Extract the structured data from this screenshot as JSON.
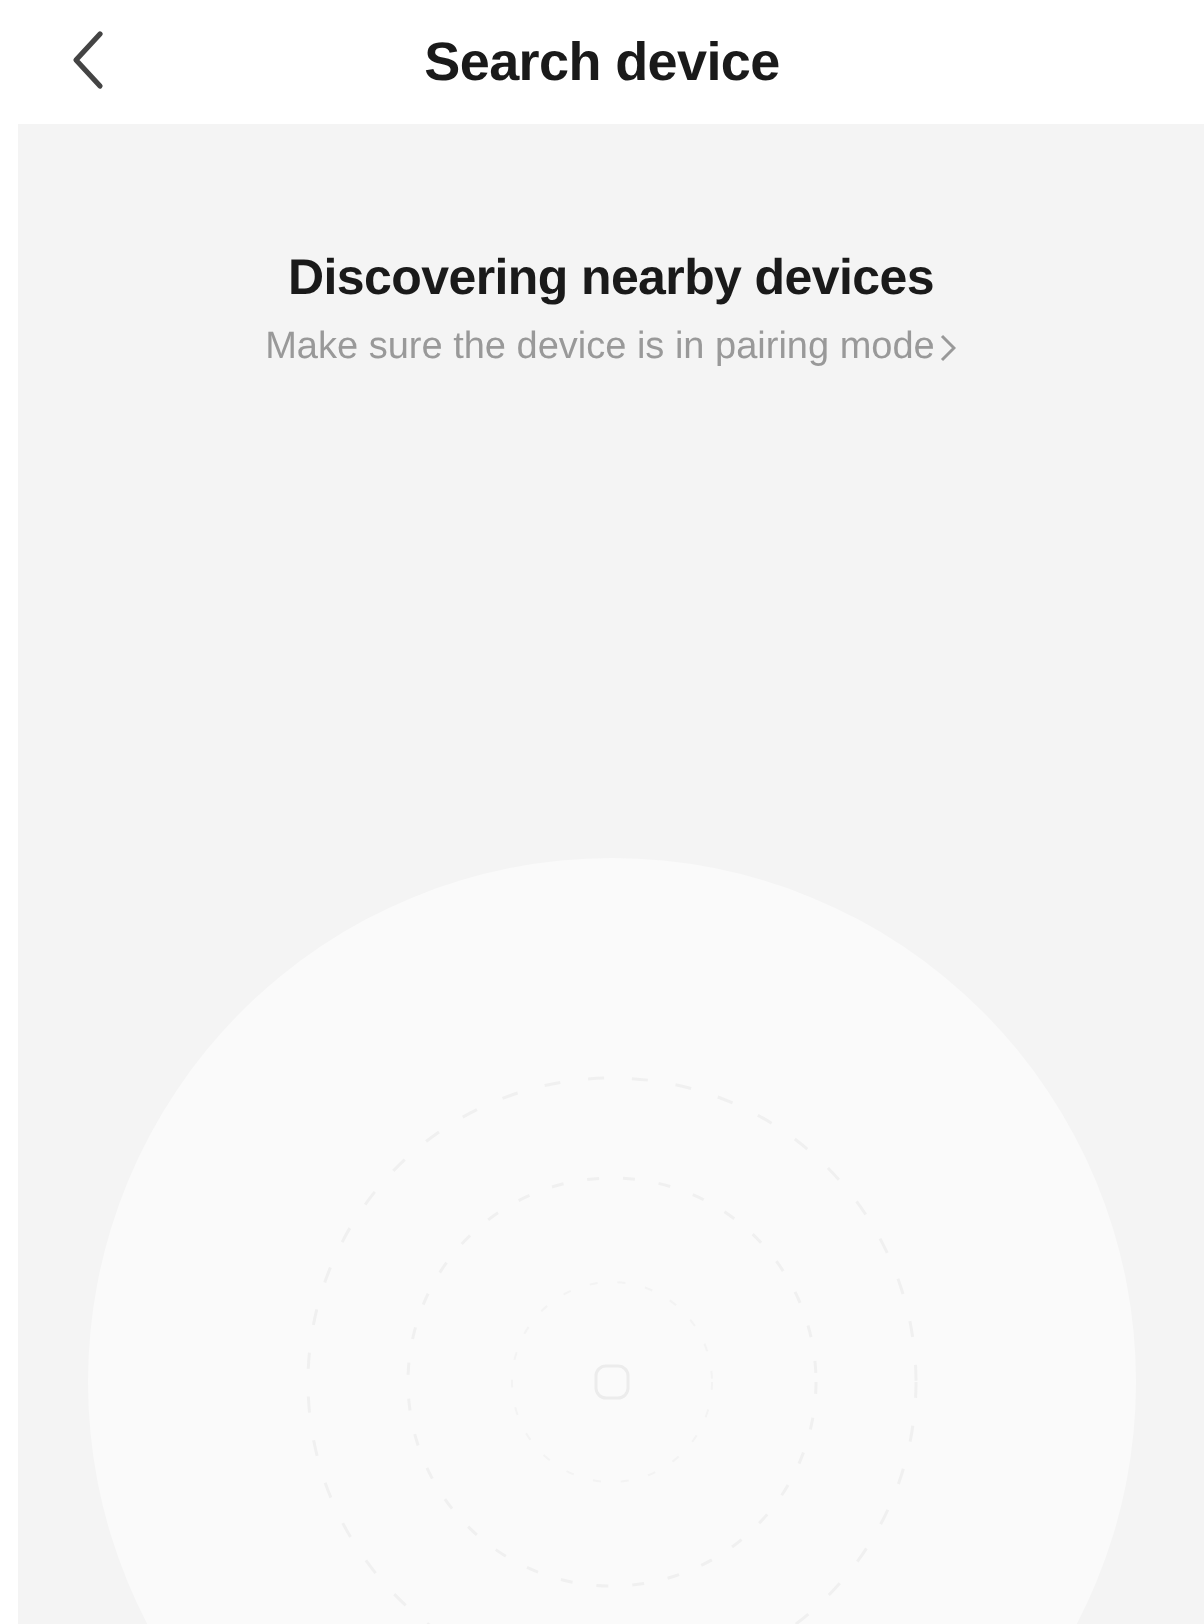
{
  "header": {
    "title": "Search device"
  },
  "scan": {
    "title": "Discovering nearby devices",
    "hint": "Make sure the device is in pairing mode"
  }
}
